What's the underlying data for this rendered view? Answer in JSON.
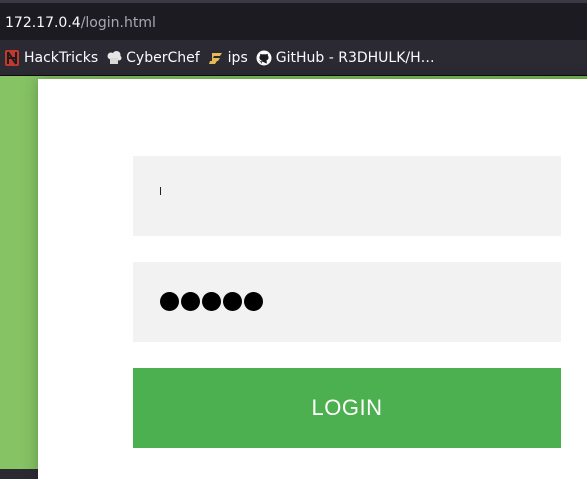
{
  "browser": {
    "url_host": "172.17.0.4",
    "url_path": "/login.html"
  },
  "bookmarks": [
    {
      "label": "HackTricks",
      "icon": "hacktricks-icon"
    },
    {
      "label": "CyberChef",
      "icon": "chef-hat-icon"
    },
    {
      "label": "ips",
      "icon": "ips-icon"
    },
    {
      "label": "GitHub - R3DHULK/H…",
      "icon": "github-icon"
    }
  ],
  "login_form": {
    "username_value": "",
    "password_mask_count": 5,
    "login_label": "LOGIN"
  },
  "colors": {
    "button": "#4caf50",
    "background_green": "#7dbf5c",
    "field_bg": "#f2f2f2"
  }
}
